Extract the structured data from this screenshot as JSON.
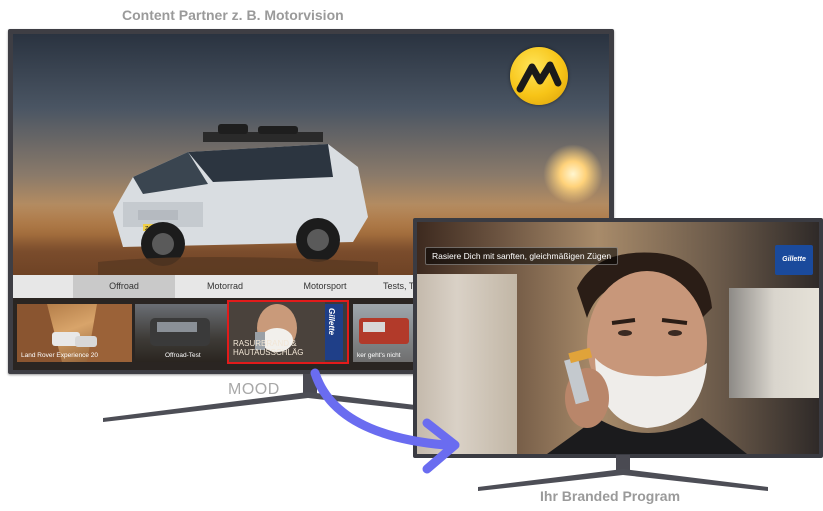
{
  "captions": {
    "top": "Content Partner z. B. Motorvision",
    "mood": "MOOD",
    "bottom": "Ihr Branded Program"
  },
  "tv1": {
    "logo": "motorvision-logo",
    "tabs": [
      {
        "label": "Offroad",
        "selected": true
      },
      {
        "label": "Motorrad",
        "selected": false
      },
      {
        "label": "Motorsport",
        "selected": false
      },
      {
        "label": "Tests, T",
        "selected": false
      }
    ],
    "thumbnails": [
      {
        "label": "Land Rover Experience 20"
      },
      {
        "label": "Offroad-Test"
      },
      {
        "label": "RASURBRAND & HAUTAUSSCHLÄG",
        "brand": "Gillette",
        "highlighted": true
      },
      {
        "label": "ker geht's nicht"
      }
    ],
    "car_plate": "Z-6-363"
  },
  "tv2": {
    "subtitle": "Rasiere Dich mit sanften, gleichmäßigen Zügen",
    "brand_logo": "Gillette"
  },
  "colors": {
    "highlight_border": "#e21b1b",
    "arrow": "#6a6cf0",
    "caption": "#9a9a9a"
  }
}
